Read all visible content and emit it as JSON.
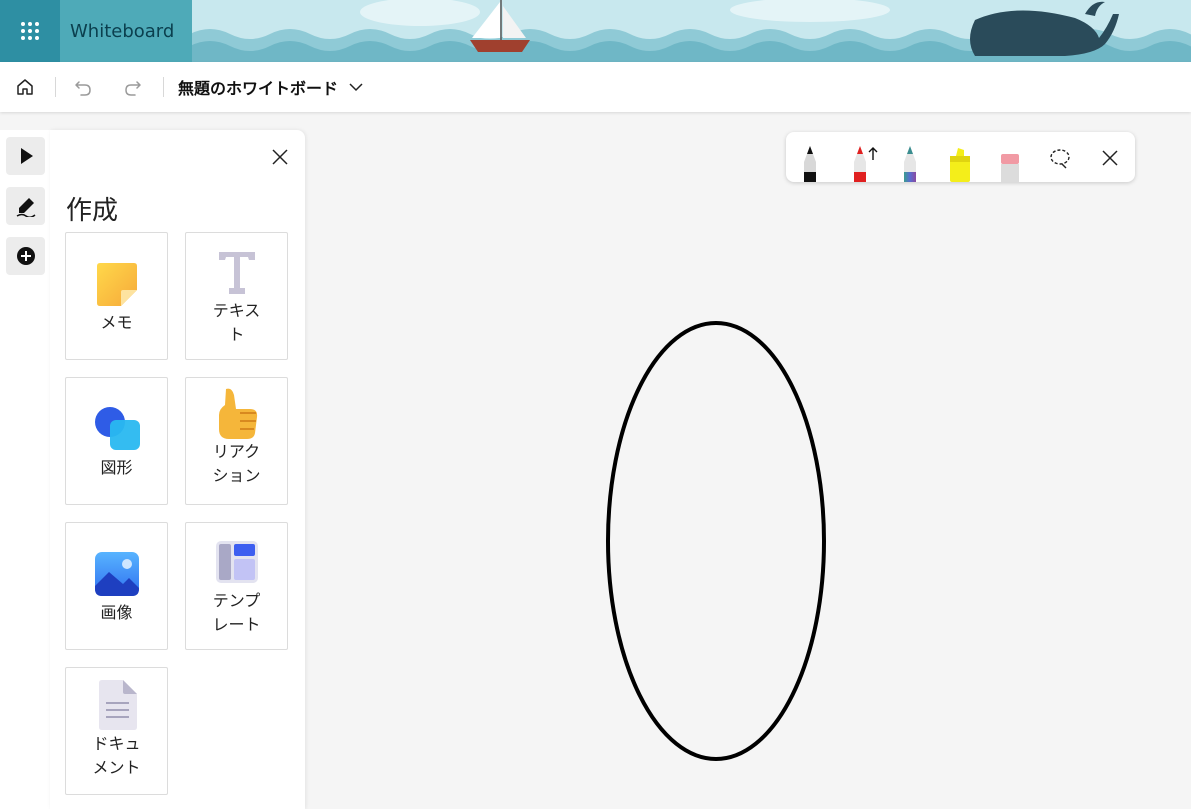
{
  "app": {
    "title": "Whiteboard"
  },
  "header": {
    "board_title": "無題のホワイトボード"
  },
  "create_panel": {
    "heading": "作成",
    "tiles": [
      {
        "label": "メモ",
        "icon": "sticky-note-icon"
      },
      {
        "label": "テキスト",
        "icon": "text-icon"
      },
      {
        "label": "図形",
        "icon": "shapes-icon"
      },
      {
        "label": "リアクション",
        "icon": "thumbs-up-icon"
      },
      {
        "label": "画像",
        "icon": "image-icon"
      },
      {
        "label": "テンプレート",
        "icon": "template-icon"
      },
      {
        "label": "ドキュメント",
        "icon": "document-icon"
      }
    ]
  },
  "ink_toolbar": {
    "tools": [
      "black-pen",
      "red-pen",
      "galaxy-pen",
      "yellow-highlighter",
      "eraser",
      "lasso-select"
    ],
    "colors": {
      "black": "#111111",
      "red": "#e02020",
      "highlighter": "#f4ee1a"
    }
  },
  "colors": {
    "banner": "#bde3ea",
    "waffle_bg": "#2e8fa3",
    "brand_bg": "#4eaab8",
    "canvas": "#f5f5f5"
  }
}
